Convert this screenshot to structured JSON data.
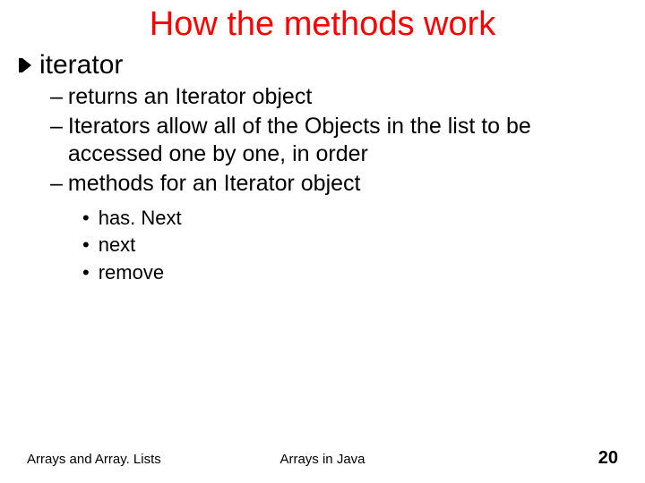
{
  "title": "How the methods work",
  "item": {
    "name": "iterator",
    "points": [
      "returns an Iterator object",
      "Iterators allow all of the Objects in the list to be accessed one by one, in order",
      "methods for an Iterator object"
    ],
    "methods": [
      "has. Next",
      "next",
      "remove"
    ]
  },
  "footer": {
    "left": "Arrays and Array. Lists",
    "center": "Arrays in Java",
    "page": "20"
  },
  "glyphs": {
    "dash": "–",
    "dot": "•"
  }
}
